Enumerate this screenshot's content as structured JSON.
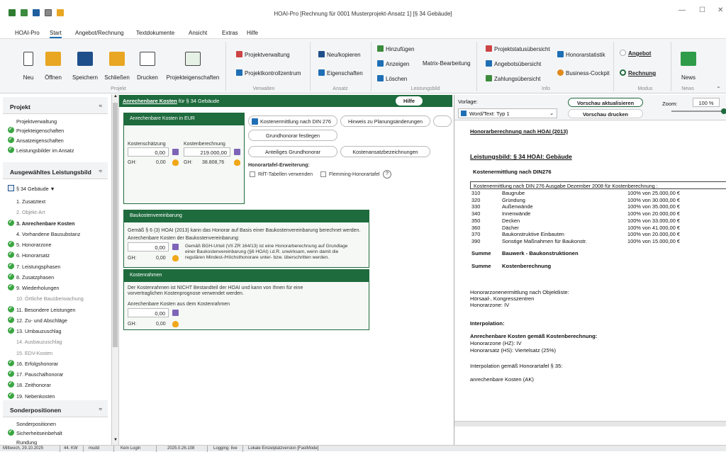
{
  "window": {
    "title": "HOAI-Pro [Rechnung für 0001 Musterprojekt-Ansatz 1] [§ 34 Gebäude]"
  },
  "menu": [
    "HOAI-Pro",
    "Start",
    "Angebot/Rechnung",
    "Textdokumente",
    "Ansicht",
    "Extras",
    "Hilfe"
  ],
  "ribbon": {
    "projekt": {
      "buttons": [
        "Neu",
        "Öffnen",
        "Speichern",
        "Schließen",
        "Drucken",
        "Projekteigenschaften"
      ],
      "group": "Projekt"
    },
    "verwalten": {
      "items": [
        "Projektverwaltung",
        "Projektkontrollzentrum"
      ],
      "group": "Verwalten"
    },
    "ansatz": {
      "items": [
        "Neu/kopieren",
        "Eigenschaften"
      ],
      "group": "Ansatz"
    },
    "leistungsbild": {
      "items": [
        "Hinzufügen",
        "Anzeigen",
        "Löschen",
        "Matrix-Bearbeitung"
      ],
      "group": "Leistungsbild"
    },
    "info": {
      "items": [
        "Projektstatusübersicht",
        "Angebotsübersicht",
        "Zahlungsübersicht",
        "Honorarstatistik",
        "Business-Cockpit"
      ],
      "group": "Info"
    },
    "modus": {
      "items": [
        "Angebot",
        "Rechnung"
      ],
      "group": "Modus"
    },
    "news": {
      "button": "News",
      "group": "News"
    }
  },
  "sidebar": {
    "projekt": {
      "title": "Projekt",
      "items": [
        "Projektverwaltung",
        "Projekteigenschaften",
        "Ansatzeigenschaften",
        "Leistungsbilder im Ansatz"
      ]
    },
    "leistungsbild": {
      "title": "Ausgewähltes Leistungsbild",
      "selector": "§ 34 Gebäude ▼",
      "items": [
        "1. Zusatztext",
        "2. Objekt-Art",
        "3. Anrechenbare Kosten",
        "4. Vorhandene Bausubstanz",
        "5. Honorarzone",
        "6. Honorarsatz",
        "7. Leistungsphasen",
        "8. Zusatzphasen",
        "9. Wiederholungen",
        "10. Örtliche Bauüberwachung",
        "11. Besondere Leistungen",
        "12. Zu- und Abschläge",
        "13. Umbauzuschlag",
        "14. Ausbauzuschlag",
        "15. EDV-Kosten",
        "16. Erfolgshonorar",
        "17. Pauschalhonorar",
        "18. Zeithonorar",
        "19. Nebenkosten"
      ]
    },
    "sonder": {
      "title": "Sonderpositionen",
      "items": [
        "Sonderpositionen",
        "Sicherheitseinbehalt",
        "Rundung"
      ]
    }
  },
  "main": {
    "header": {
      "link": "Anrechenbare Kosten",
      "suffix": " für § 34 Gebäude",
      "help": "Hilfe"
    },
    "kosten": {
      "title": "Anrechenbare Kosten in EUR",
      "schaetzung_label": "Kostenschätzung",
      "schaetzung_value": "0,00",
      "berechnung_label": "Kostenberechnung",
      "berechnung_value": "219.000,00",
      "gh_label": "GH:",
      "gh1": "0,00",
      "gh2": "38.808,76"
    },
    "buttons": [
      "Kostenermittlung nach DIN 276",
      "Hinweis zu Planungsänderungen",
      "Grundhonorar festlegen",
      "Anteiliges Grundhonorar",
      "Kostenansatzbezeichnungen"
    ],
    "erweiterung": {
      "title": "Honorartafel-Erweiterung:",
      "opt1": "RifT-Tabellen verwenden",
      "opt2": "Flemming-Honorartafel",
      "help": "?"
    },
    "bauvereinbarung": {
      "title": "Baukostenvereinbarung",
      "text": "Gemäß § 6 (3) HOAI (2013) kann das Honorar auf Basis einer Baukostenvereinbarung berechnet werden.",
      "label": "Anrechenbare Kosten der Baukostenvereinbarung:",
      "value": "0,00",
      "gh": "0,00",
      "note1": "Gemäß BGH-Urteil (VII ZR 164/13) ist eine Honorarberechnung auf Grundlage",
      "note2": "einer Baukostenvereinbarung (§6 HOAI) i.d.R. unwirksam, wenn damit die",
      "note3": "regulären Mindest-/Höchsthonorare unter- bzw. überschritten werden."
    },
    "rahmen": {
      "title": "Kostenrahmen",
      "text1": "Der Kostenrahmen ist NICHT Bestandteil der HOAI und kann von Ihnen für eine",
      "text2": "vorvertraglichen Kostenprognose verwendet werden.",
      "label": "Anrechenbare Kosten aus dem Kostenrahmen",
      "value": "0,00",
      "gh": "0,00"
    }
  },
  "preview": {
    "vorlage_label": "Vorlage:",
    "vorlage_value": "Word/Text: Typ 1",
    "refresh": "Vorschau aktualisieren",
    "print": "Vorschau drucken",
    "zoom_label": "Zoom:",
    "zoom": "100 %",
    "doc": {
      "heading": "Honorarberechnung nach HOAI (2013)",
      "leistungsbild": "Leistungsbild: § 34 HOAI: Gebäude",
      "kosten_title": "Kostenermittlung nach DIN276",
      "table_caption": "Kostenermittlung nach DIN 276 Ausgabe Dezember 2008  für Kostenberechnung :",
      "rows": [
        {
          "code": "310",
          "name": "Baugrube",
          "value": "100% von 25.000,00 €"
        },
        {
          "code": "320",
          "name": "Gründung",
          "value": "100% von 30.000,00 €"
        },
        {
          "code": "330",
          "name": "Außenwände",
          "value": "100% von 35.000,00 €"
        },
        {
          "code": "340",
          "name": "Innenwände",
          "value": "100% von 20.000,00 €"
        },
        {
          "code": "350",
          "name": "Decken",
          "value": "100% von 33.000,00 €"
        },
        {
          "code": "360",
          "name": "Dächer",
          "value": "100% von 41.000,00 €"
        },
        {
          "code": "370",
          "name": "Baukonstruktive Einbauten",
          "value": "100% von 20.000,00 €"
        },
        {
          "code": "390",
          "name": "Sonstige Maßnahmen für Baukonstr.",
          "value": "100% von 15.000,00 €"
        }
      ],
      "summe1_label": "Summe",
      "summe1_text": "Bauwerk - Baukonstruktionen",
      "summe2_label": "Summe",
      "summe2_text": "Kostenberechnung",
      "zone1": "Honorarzonenermittlung nach Objektliste:",
      "zone2": "Hörsaal-, Kongresszentren",
      "zone3": "Honorarzone: IV",
      "interp": "Interpolation:",
      "ak_title": "Anrechenbare Kosten gemäß Kostenberechnung:",
      "hz": "Honorarzone (HZ): IV",
      "hs": "Honorarsatz  (HS): Viertelsatz (25%)",
      "tafel": "Interpolation gemäß Honorartafel § 35:",
      "ak": "anrechenbare Kosten (AK)"
    }
  },
  "status": [
    "Mittwoch, 29.10.2025",
    "44. KW",
    "mudd",
    "Kein Login",
    "2025.0.26.108",
    "Logging: live",
    "Lokale Einzelplatzversion [FastMode]"
  ]
}
